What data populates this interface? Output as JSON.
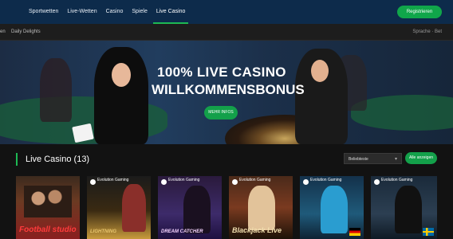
{
  "nav": {
    "items": [
      "Sportwetten",
      "Live-Wetten",
      "Casino",
      "Spiele",
      "Live Casino"
    ],
    "active_index": 4
  },
  "register_label": "Registrieren",
  "subbar": {
    "left_cut": "en",
    "item": "Daily Delights",
    "lang_cut": "Sprache · Bet"
  },
  "hero": {
    "headline_1": "100% LIVE CASINO",
    "headline_2": "WILLKOMMENSBONUS",
    "more_label": "MEHR INFOS"
  },
  "section": {
    "title": "Live Casino (13)",
    "sort_selected": "Beliebteste",
    "show_all_label": "Alle anzeigen"
  },
  "tiles": [
    {
      "provider": "",
      "title": "Football studio",
      "flag": ""
    },
    {
      "provider": "Evolution Gaming",
      "title": "LIGHTNING",
      "flag": ""
    },
    {
      "provider": "Evolution Gaming",
      "title": "DREAM CATCHER",
      "flag": ""
    },
    {
      "provider": "Evolution Gaming",
      "title": "Blackjack Live",
      "flag": ""
    },
    {
      "provider": "Evolution Gaming",
      "title": "",
      "flag": "germany"
    },
    {
      "provider": "Evolution Gaming",
      "title": "",
      "flag": "sweden"
    }
  ],
  "colors": {
    "topbar": "#0d2b4b",
    "accent_green": "#1db954",
    "button_green": "#13a04a",
    "background": "#121212"
  }
}
